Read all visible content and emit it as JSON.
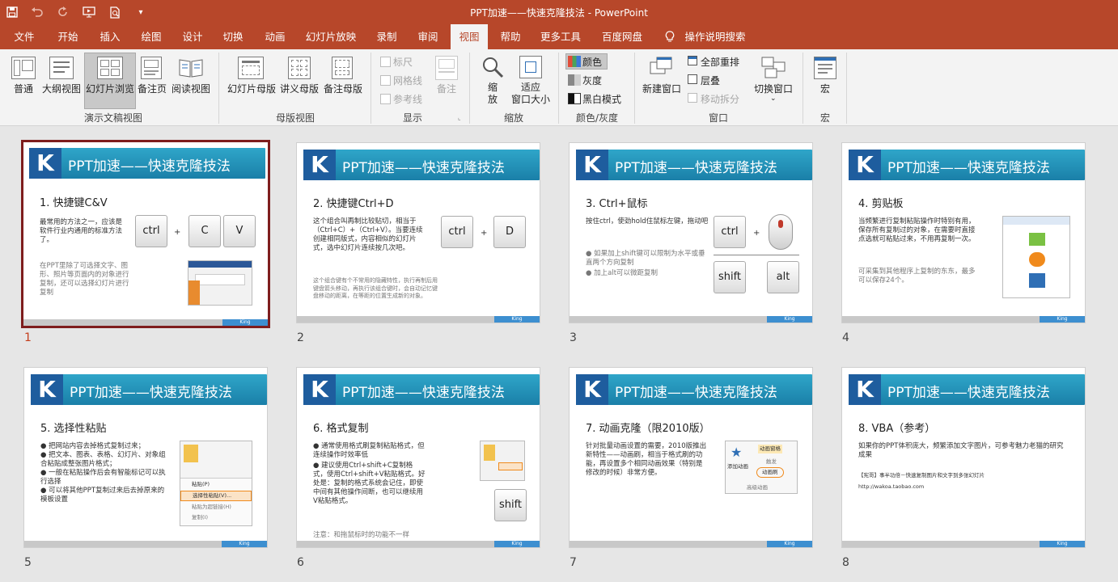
{
  "window": {
    "title": "PPT加速——快速克隆技法  -  PowerPoint"
  },
  "qat": {
    "save": "save-icon",
    "undo": "undo-icon",
    "redo": "redo-icon",
    "present": "present-icon",
    "preview": "print-preview-icon",
    "customize": "▾"
  },
  "tabs": [
    "文件",
    "开始",
    "插入",
    "绘图",
    "设计",
    "切换",
    "动画",
    "幻灯片放映",
    "录制",
    "审阅",
    "视图",
    "帮助",
    "更多工具",
    "百度网盘",
    "操作说明搜索"
  ],
  "active_tab": "视图",
  "ribbon": {
    "views": {
      "normal": "普通",
      "outline": "大纲视图",
      "sorter": "幻灯片浏览",
      "notes": "备注页",
      "reading": "阅读视图",
      "group": "演示文稿视图"
    },
    "masters": {
      "slide": "幻灯片母版",
      "handout": "讲义母版",
      "notes": "备注母版",
      "group": "母版视图"
    },
    "show": {
      "ruler": "标尺",
      "gridlines": "网格线",
      "guides": "参考线",
      "notes": "备注",
      "group": "显示"
    },
    "zoom": {
      "zoom": "缩\n放",
      "fit": "适应\n窗口大小",
      "group": "缩放"
    },
    "color": {
      "color": "颜色",
      "grayscale": "灰度",
      "bw": "黑白模式",
      "group": "颜色/灰度"
    },
    "window": {
      "new": "新建窗口",
      "arrange": "全部重排",
      "cascade": "层叠",
      "move": "移动拆分",
      "switch": "切换窗口",
      "group": "窗口"
    },
    "macros": {
      "macro": "宏",
      "group": "宏"
    }
  },
  "slides": [
    {
      "num": "1",
      "banner": "PPT加速——快速克隆技法",
      "heading": "1. 快捷键C&V",
      "text1": "最常用的方法之一，应该是软件行业内通用的标准方法了。",
      "text2": "在PPT里除了可选择文字、图形、照片等页面内的对象进行复制，还可以选择幻灯片进行复制",
      "keys": [
        "ctrl",
        "C",
        "V"
      ],
      "plus": "+",
      "footer": "King"
    },
    {
      "num": "2",
      "banner": "PPT加速——快速克隆技法",
      "heading": "2. 快捷键Ctrl+D",
      "text1": "这个组合叫再制比较贴切，相当于（Ctrl+C）+（Ctrl+V）。当要连续创建相同版式，内容相似的幻灯片式，选中幻灯片连续按几次吧。",
      "text2": "这个组合键有个不常用的隐藏特性，执行再制后用键盘箭头移动，再执行该组合键时，会自动记忆键盘移动的距离，在等距的位置生成新的对象。",
      "keys": [
        "ctrl",
        "D"
      ],
      "plus": "+",
      "footer": "King"
    },
    {
      "num": "3",
      "banner": "PPT加速——快速克隆技法",
      "heading": "3. Ctrl+鼠标",
      "text1": "按住ctrl，使劲hold住鼠标左键，拖动吧",
      "bullets": [
        "如果加上shift键可以限制为水平或垂直两个方向复制",
        "加上alt可以微距复制"
      ],
      "keys": [
        "ctrl",
        "shift",
        "alt"
      ],
      "plus": "+",
      "footer": "King"
    },
    {
      "num": "4",
      "banner": "PPT加速——快速克隆技法",
      "heading": "4. 剪贴板",
      "text1": "当频繁进行复制粘贴操作时特别有用，保存所有复制过的对象，在需要时直接点选就可粘贴过来，不用再复制一次。",
      "text2": "可采集到其他程序上复制的东东，最多可以保存24个。",
      "footer": "King"
    },
    {
      "num": "5",
      "banner": "PPT加速——快速克隆技法",
      "heading": "5. 选择性粘贴",
      "bullets": [
        "把网站内容去掉格式复制过来；",
        "把文本、图表、表格、幻灯片、对象组合粘贴成整张图片格式；",
        "一般在粘贴操作后会有智能标记可以执行选择",
        "可以将其他PPT复制过来后去掉原来的模板设置"
      ],
      "menu": [
        "粘贴(P)",
        "选择性粘贴(V)...",
        "粘贴为超链接(H)",
        "复制(I)"
      ],
      "footer": "King"
    },
    {
      "num": "6",
      "banner": "PPT加速——快速克隆技法",
      "heading": "6. 格式复制",
      "bullets": [
        "通常使用格式刷复制粘贴格式，但连续操作时效率低",
        "建议使用Ctrl+shift+C复制格式，使用Ctrl+shift+V粘贴格式。好处是：复制的格式系统会记住，即使中间有其他操作间断，也可以继续用V粘贴格式。"
      ],
      "note": "注意：和拖鼠标时的功能不一样",
      "keys": [
        "shift"
      ],
      "footer": "King"
    },
    {
      "num": "7",
      "banner": "PPT加速——快速克隆技法",
      "heading": "7. 动画克隆（限2010版）",
      "text1": "针对批量动画设置的需要，2010版推出新特性——动画刷，相当于格式刷的功能，再设置多个相同动画效果（特别是修改的时候）非常方便。",
      "anim": [
        "添加动画",
        "动画窗格",
        "触发",
        "动画刷",
        "高级动画"
      ],
      "footer": "King"
    },
    {
      "num": "8",
      "banner": "PPT加速——快速克隆技法",
      "heading": "8. VBA（参考）",
      "text1": "如果你的PPT体积庞大，频繁添加文字图片，可参考魅力老猫的研究成果",
      "text2": "【宪哥】事半功倍－快速复制图片和文字到多张幻灯片",
      "text3": "http://wakoa.taobao.com",
      "footer": "King"
    }
  ],
  "colors": {
    "accent": "#b7472a",
    "selected_border": "#7e1d1d",
    "banner": "#2fa6c9",
    "logo": "#1e5d9e"
  }
}
